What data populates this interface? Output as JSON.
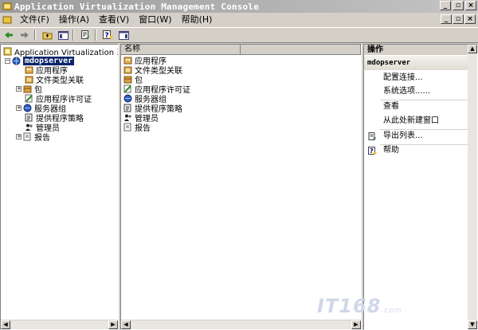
{
  "window": {
    "title": "Application Virtualization Management Console"
  },
  "menu": [
    "文件(F)",
    "操作(A)",
    "查看(V)",
    "窗口(W)",
    "帮助(H)"
  ],
  "tree": {
    "root": "Application Virtualization 系",
    "server": "mdopserver",
    "children": [
      "应用程序",
      "文件类型关联",
      "包",
      "应用程序许可证",
      "服务器组",
      "提供程序策略",
      "管理员",
      "报告"
    ]
  },
  "list": {
    "column": "名称",
    "items": [
      "应用程序",
      "文件类型关联",
      "包",
      "应用程序许可证",
      "服务器组",
      "提供程序策略",
      "管理员",
      "报告"
    ]
  },
  "actions": {
    "header": "操作",
    "section": "mdopserver",
    "items": [
      "配置连接...",
      "系统选项......",
      "查看",
      "从此处新建窗口",
      "导出列表...",
      "帮助"
    ]
  },
  "watermark": {
    "main": "IT168",
    "suffix": ".com"
  },
  "colors": {
    "selection": "#0a246a",
    "title_bar": "#9c9c9c"
  }
}
